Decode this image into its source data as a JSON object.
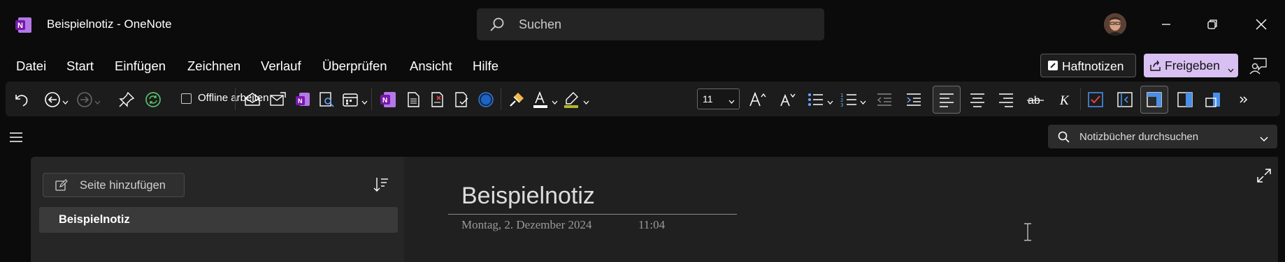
{
  "window": {
    "title": "Beispielnotiz  -  OneNote",
    "search_placeholder": "Suchen"
  },
  "menu": {
    "items": [
      "Datei",
      "Start",
      "Einfügen",
      "Zeichnen",
      "Verlauf",
      "Überprüfen",
      "Ansicht",
      "Hilfe"
    ],
    "sticky_notes_label": "Haftnotizen",
    "share_label": "Freigeben"
  },
  "ribbon": {
    "offline_label": "Offline arbeiten",
    "font_size": "11",
    "icons": [
      "undo-icon",
      "back-icon",
      "forward-icon",
      "pin-icon",
      "sync-icon",
      "email-page-icon",
      "send-icon",
      "send-to-onenote-icon",
      "find-tags-icon",
      "meeting-details-icon",
      "onenote-icon",
      "page-icon",
      "immersive-reader-icon",
      "dictate-icon",
      "record-icon",
      "format-painter-icon",
      "font-color-icon",
      "highlight-icon",
      "grow-font-icon",
      "shrink-font-icon",
      "bullets-icon",
      "numbering-icon",
      "outdent-icon",
      "indent-icon",
      "align-left-icon",
      "align-center-icon",
      "align-right-icon",
      "strikethrough-icon",
      "italic-icon",
      "todo-tag-icon",
      "navigation-icon",
      "page-view-icon",
      "split-view-icon",
      "full-view-icon",
      "more-icon"
    ]
  },
  "sidebar": {
    "notebook_search_placeholder": "Notizbücher durchsuchen",
    "add_page_label": "Seite hinzufügen",
    "pages": [
      {
        "title": "Beispielnotiz",
        "selected": true
      }
    ]
  },
  "note": {
    "title": "Beispielnotiz",
    "date": "Montag, 2. Dezember 2024",
    "time": "11:04"
  },
  "colors": {
    "background": "#0b0b0b",
    "ribbon": "#1c1c1c",
    "share_button": "#d8c0f2",
    "onenote_purple": "#7719aa",
    "font_color_bar": "#ffffff",
    "highlight_bar": "#b5b52a",
    "todo_checkbox": "#e04444"
  }
}
